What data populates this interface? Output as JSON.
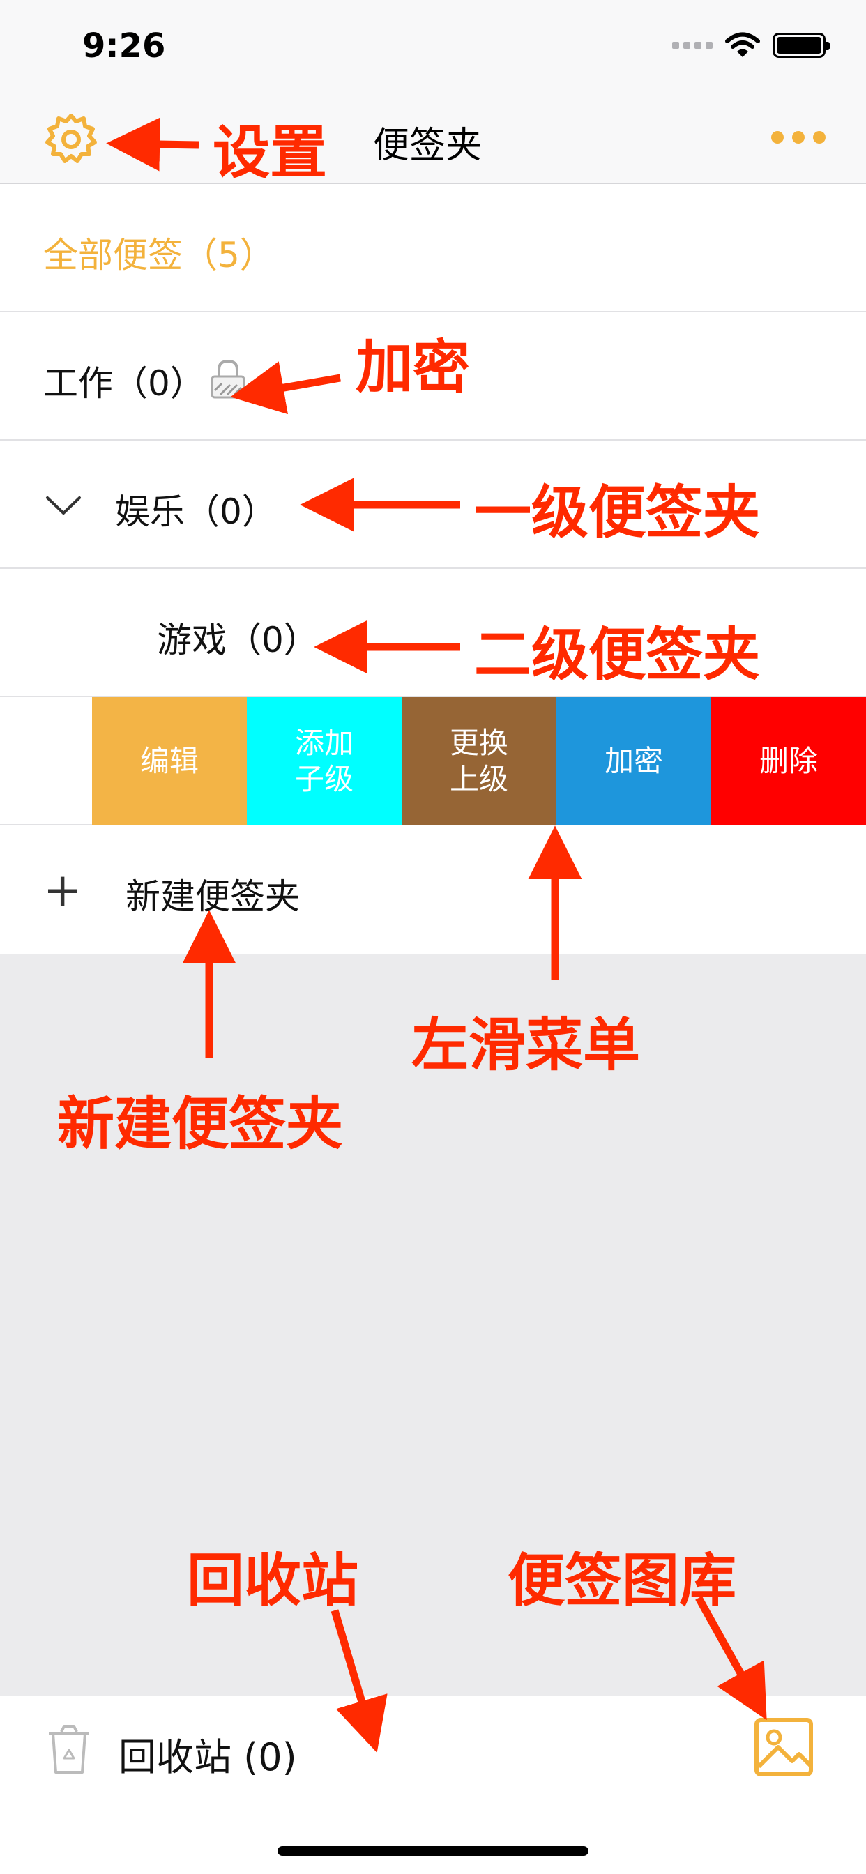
{
  "status": {
    "time": "9:26"
  },
  "nav": {
    "title": "便签夹"
  },
  "folders": {
    "all": "全部便签（5）",
    "work": "工作（0）",
    "fun": "娱乐（0）",
    "game": "游戏（0）"
  },
  "swipe_menu": [
    {
      "label": "编辑",
      "color": "#f3b446"
    },
    {
      "label": "添加子级",
      "color": "#00ffff"
    },
    {
      "label": "更换上级",
      "color": "#966535"
    },
    {
      "label": "加密",
      "color": "#1e96dc"
    },
    {
      "label": "删除",
      "color": "#ff0000"
    }
  ],
  "new_folder": {
    "plus": "+",
    "label": "新建便签夹"
  },
  "bottom": {
    "trash": "回收站 (0)"
  },
  "annotations": {
    "settings": "设置",
    "lock": "加密",
    "level1": "一级便签夹",
    "level2": "二级便签夹",
    "swipe": "左滑菜单",
    "new_folder": "新建便签夹",
    "trash": "回收站",
    "gallery": "便签图库"
  },
  "colors": {
    "accent": "#f3b23c",
    "annotation": "#ff2a00"
  },
  "icons": [
    "gear-icon",
    "more-icon",
    "lock-icon",
    "chevron-down-icon",
    "plus-icon",
    "trash-icon",
    "image-icon"
  ]
}
